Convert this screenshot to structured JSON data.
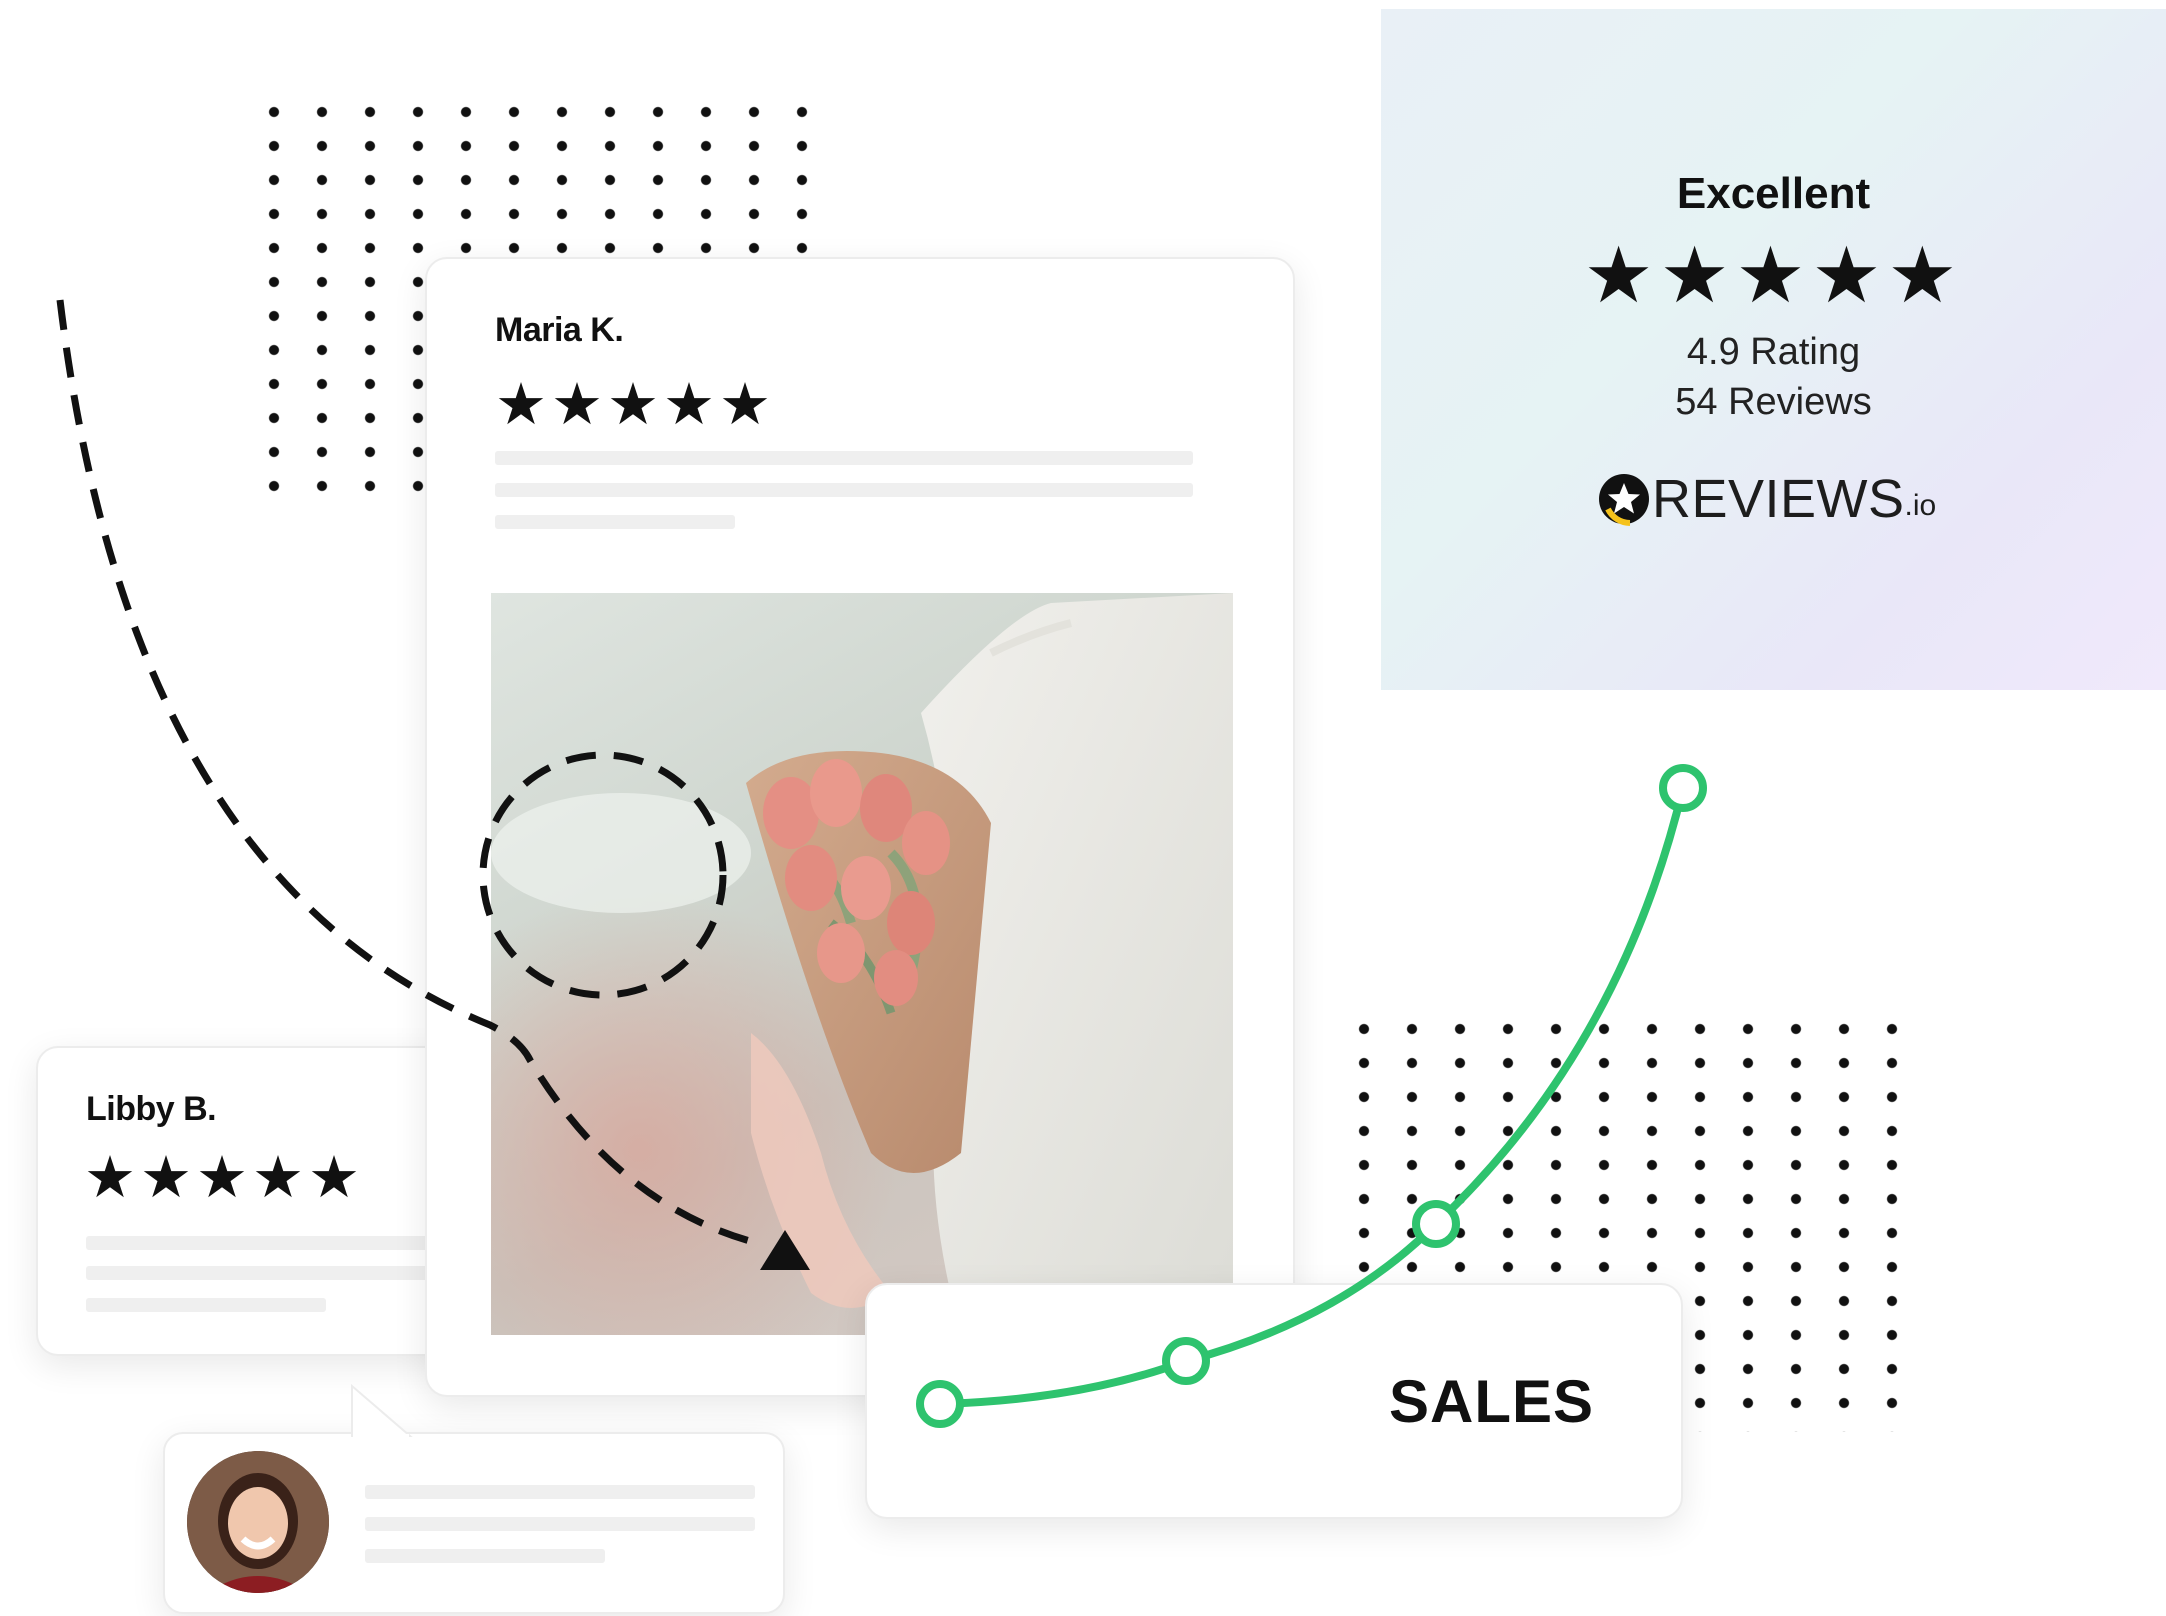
{
  "review_card_main": {
    "reviewer": "Maria K.",
    "stars": "★★★★★"
  },
  "review_card_secondary": {
    "reviewer": "Libby B.",
    "stars": "★★★★★"
  },
  "rating_summary": {
    "heading": "Excellent",
    "stars": "★★★★★",
    "rating_text": "4.9 Rating",
    "reviews_text": "54 Reviews",
    "brand": "REVIEWS",
    "brand_suffix": ".io"
  },
  "sales_card": {
    "label": "SALES"
  },
  "colors": {
    "growth_line": "#2ec36e",
    "gradient_start": "#e6f3f4",
    "gradient_end": "#efe8fb"
  },
  "icons": [
    "star-icon",
    "reviews-io-logo-icon",
    "arrow-head-icon",
    "avatar"
  ]
}
